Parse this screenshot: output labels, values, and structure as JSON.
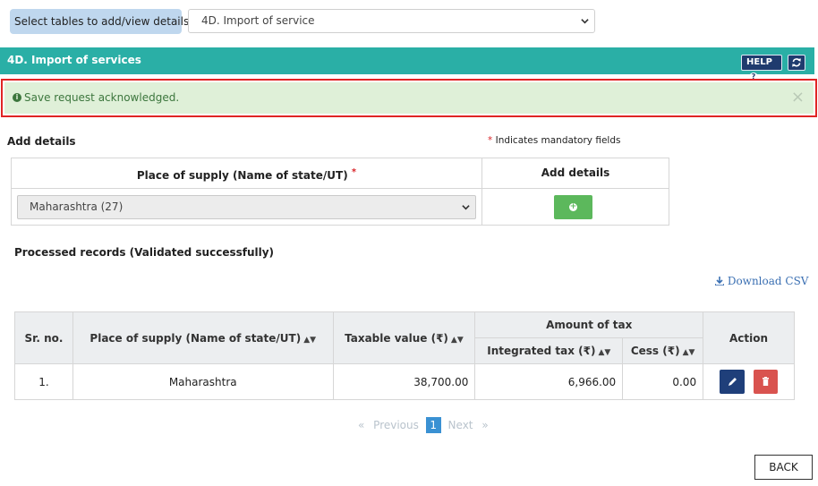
{
  "selector": {
    "label": "Select tables to add/view details",
    "selected": "4D. Import of service"
  },
  "header": {
    "title": "4D. Import of services",
    "help_label": "HELP"
  },
  "alert": {
    "message": "Save request acknowledged.",
    "close": "×"
  },
  "add_details": {
    "title": "Add details",
    "mandatory_star": "*",
    "mandatory_note": "Indicates mandatory fields",
    "col_place": "Place of supply (Name of state/UT)",
    "col_add": "Add details",
    "state_value": "Maharashtra (27)"
  },
  "processed": {
    "title": "Processed records (Validated successfully)",
    "download_label": "Download CSV"
  },
  "records_table": {
    "headers": {
      "sr": "Sr. no.",
      "place": "Place of supply (Name of state/UT)",
      "taxable": "Taxable value (₹)",
      "amount": "Amount of tax",
      "igst": "Integrated tax (₹)",
      "cess": "Cess (₹)",
      "action": "Action"
    },
    "rows": [
      {
        "sr": "1.",
        "place": "Maharashtra",
        "taxable": "38,700.00",
        "igst": "6,966.00",
        "cess": "0.00"
      }
    ]
  },
  "pagination": {
    "prev_arrow": "«",
    "previous": "Previous",
    "page": "1",
    "next": "Next",
    "next_arrow": "»"
  },
  "back_label": "BACK",
  "colors": {
    "header_bar": "#2aafa6",
    "alert_bg": "#dff0d8",
    "alert_border": "#e02424",
    "add_button": "#5cb85c",
    "edit_button": "#1f3f7a",
    "delete_button": "#d9534f"
  }
}
